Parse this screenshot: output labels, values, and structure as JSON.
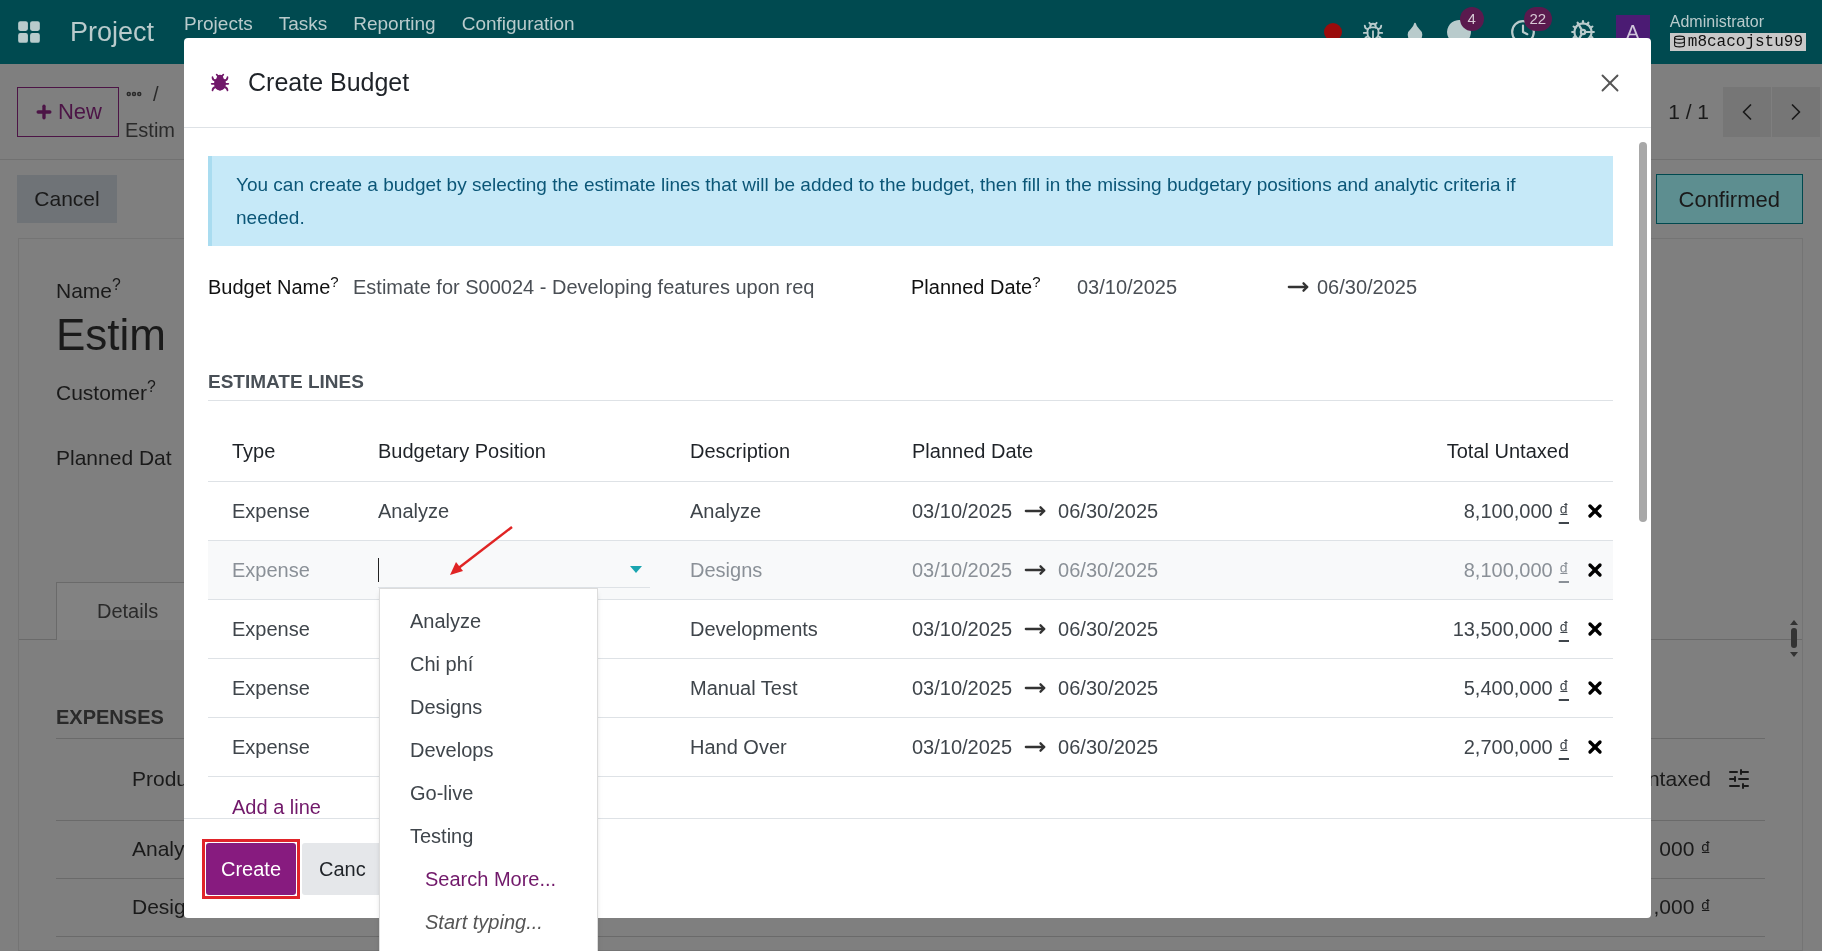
{
  "navbar": {
    "app": "Project",
    "menu": [
      "Projects",
      "Tasks",
      "Reporting",
      "Configuration"
    ],
    "chat_badge": "4",
    "activity_badge": "22",
    "avatar": "A",
    "user": "Administrator",
    "database": "m8cacojstu99"
  },
  "page": {
    "new_button": "New",
    "breadcrumb_separator": "/",
    "record": "Estim",
    "pager": "1 / 1",
    "cancel_button": "Cancel",
    "status": "Confirmed",
    "name_label": "Name$^{?}$",
    "title": "Estim",
    "customer_label": "Customer$^{?}$",
    "planned_date_label": "Planned Dat",
    "tabs": [
      {
        "label": "Details",
        "selected": true
      }
    ],
    "section": "EXPENSES",
    "columns": [
      "Produ",
      "ntaxed"
    ],
    "rows": [
      [
        "Analy",
        "000 ₫"
      ],
      [
        "Desig",
        ",000 ₫"
      ]
    ]
  },
  "modal": {
    "title": "Create Budget",
    "notice": "You can create a budget by selecting the estimate lines that will be added to the budget, then fill in the missing budgetary positions and analytic criteria if needed.",
    "budget_name_label": "Budget Name$^{?}$",
    "budget_name": "Estimate for S00024 - Developing features upon req",
    "planned_date_label": "Planned Date$^{?}$",
    "date_start": "03/10/2025",
    "date_end": "06/30/2025",
    "section": "ESTIMATE LINES",
    "columns": [
      "Type",
      "Budgetary Position",
      "Description",
      "Planned Date",
      "Total Untaxed"
    ],
    "lines": [
      {
        "type": "Expense",
        "position": "Analyze",
        "description": "Analyze",
        "start": "03/10/2025",
        "end": "06/30/2025",
        "total": "8,100,000",
        "currency": "₫",
        "editing": false
      },
      {
        "type": "Expense",
        "description": "Designs",
        "start": "03/10/2025",
        "end": "06/30/2025",
        "total": "8,100,000",
        "currency": "₫",
        "editing": true
      },
      {
        "type": "Expense",
        "description": "Developments",
        "start": "03/10/2025",
        "end": "06/30/2025",
        "total": "13,500,000",
        "currency": "₫",
        "editing": false
      },
      {
        "type": "Expense",
        "description": "Manual Test",
        "start": "03/10/2025",
        "end": "06/30/2025",
        "total": "5,400,000",
        "currency": "₫",
        "editing": false
      },
      {
        "type": "Expense",
        "description": "Hand Over",
        "start": "03/10/2025",
        "end": "06/30/2025",
        "total": "2,700,000",
        "currency": "₫",
        "editing": false
      }
    ],
    "add_line": "Add a line",
    "dropdown": [
      {
        "label": "Analyze",
        "kind": "option"
      },
      {
        "label": "Chi phí",
        "kind": "option"
      },
      {
        "label": "Designs",
        "kind": "option"
      },
      {
        "label": "Develops",
        "kind": "option"
      },
      {
        "label": "Go-live",
        "kind": "option"
      },
      {
        "label": "Testing",
        "kind": "option"
      },
      {
        "label": "Search More...",
        "kind": "action"
      },
      {
        "label": "Start typing...",
        "kind": "hint"
      }
    ],
    "buttons": [
      {
        "label": "Create",
        "kind": "primary",
        "highlighted": true
      },
      {
        "label": "Canc",
        "kind": "secondary",
        "highlighted": false
      }
    ]
  }
}
